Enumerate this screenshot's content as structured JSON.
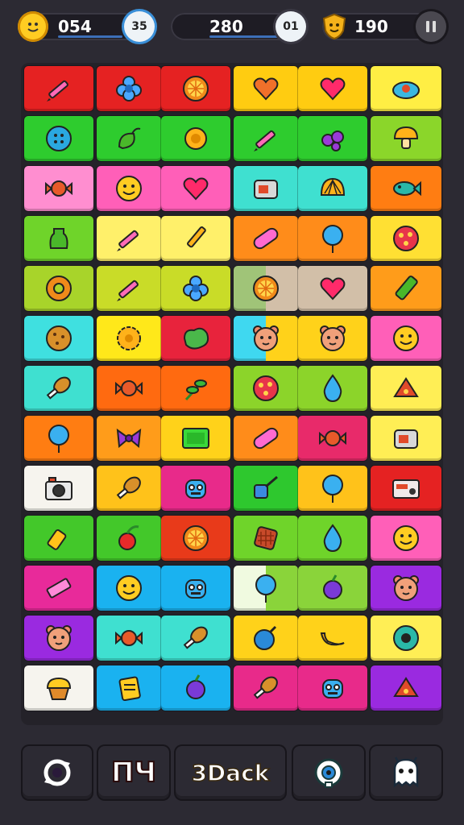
{
  "hud": {
    "coins": {
      "value": "054",
      "badge": "35"
    },
    "score": {
      "value": "280",
      "badge": "01"
    },
    "stars": {
      "value": "190"
    }
  },
  "board": {
    "rows": [
      [
        {
          "c1": "#e52222",
          "icon": "pencil-icon"
        },
        {
          "c1": "#e52222",
          "icon": "flower-icon"
        },
        {
          "c1": "#e52222",
          "icon": "citrus-slice-icon"
        },
        {
          "c1": "#ffcc11",
          "icon": "heart-icon",
          "ic": "#f0702a"
        },
        {
          "c1": "#ffcc11",
          "icon": "heart-icon"
        },
        {
          "c1": "#ffee44",
          "icon": "cloud-bird-icon"
        }
      ],
      [
        {
          "c1": "#2ecc2e",
          "icon": "button-icon"
        },
        {
          "c1": "#2ecc2e",
          "icon": "leaf-fruit-icon"
        },
        {
          "c1": "#2ecc2e",
          "icon": "sun-gear-icon"
        },
        {
          "c1": "#2ecc2e",
          "icon": "pencil-icon"
        },
        {
          "c1": "#2ecc2e",
          "icon": "berries-icon"
        },
        {
          "c1": "#8bd62a",
          "icon": "mushroom-icon"
        }
      ],
      [
        {
          "c1": "#ff8ed0",
          "icon": "candy-icon"
        },
        {
          "c1": "#ff5fb8",
          "icon": "smiley-icon"
        },
        {
          "c1": "#ff5fb8",
          "icon": "heart-icon"
        },
        {
          "c1": "#3fe0d0",
          "icon": "toaster-icon"
        },
        {
          "c1": "#3fe0d0",
          "icon": "shell-icon"
        },
        {
          "c1": "#ff7d12",
          "icon": "fish-icon"
        }
      ],
      [
        {
          "c1": "#6fd42a",
          "icon": "bottle-icon"
        },
        {
          "c1": "#fff06a",
          "icon": "pencil-icon"
        },
        {
          "c1": "#fff06a",
          "icon": "brush-icon"
        },
        {
          "c1": "#ff8c1a",
          "icon": "capsule-icon"
        },
        {
          "c1": "#ff8c1a",
          "icon": "balloon-icon"
        },
        {
          "c1": "#ffe033",
          "icon": "pizza-icon"
        }
      ],
      [
        {
          "c1": "#a8d42a",
          "icon": "donut-icon"
        },
        {
          "c1": "#c9dc28",
          "icon": "pencil-icon"
        },
        {
          "c1": "#c9dc28",
          "icon": "flower-icon"
        },
        {
          "c1": "#a0c478",
          "c2": "#d2bfa8",
          "icon": "citrus-slice-icon"
        },
        {
          "c1": "#d2bfa8",
          "icon": "heart-icon"
        },
        {
          "c1": "#ff9c1a",
          "icon": "crayon-icon"
        }
      ],
      [
        {
          "c1": "#3fe0e0",
          "icon": "cookie-icon"
        },
        {
          "c1": "#ffe81a",
          "icon": "gear-icon"
        },
        {
          "c1": "#e8233c",
          "icon": "splat-icon"
        },
        {
          "c1": "#3fd8f0",
          "c2": "#ffd21a",
          "icon": "bear-face-icon"
        },
        {
          "c1": "#ffd21a",
          "icon": "bear-face-icon"
        },
        {
          "c1": "#ff5fb8",
          "icon": "smiley-icon"
        }
      ],
      [
        {
          "c1": "#3fe0d0",
          "icon": "drumstick-icon"
        },
        {
          "c1": "#ff6a10",
          "icon": "candy-icon"
        },
        {
          "c1": "#ff6a10",
          "icon": "herb-icon"
        },
        {
          "c1": "#8cd42a",
          "icon": "pizza-icon"
        },
        {
          "c1": "#8cd42a",
          "icon": "drop-icon"
        },
        {
          "c1": "#ffee55",
          "icon": "cheese-icon"
        }
      ],
      [
        {
          "c1": "#ff7d12",
          "icon": "balloon-icon"
        },
        {
          "c1": "#ff9c1a",
          "icon": "bow-icon"
        },
        {
          "c1": "#ffd21a",
          "icon": "frame-icon"
        },
        {
          "c1": "#ff8c1a",
          "icon": "capsule-icon"
        },
        {
          "c1": "#e82a6a",
          "icon": "candy-icon"
        },
        {
          "c1": "#ffee55",
          "icon": "toaster-icon"
        }
      ],
      [
        {
          "c1": "#f6f4ee",
          "icon": "camera-icon"
        },
        {
          "c1": "#ffc21a",
          "icon": "drumstick-icon"
        },
        {
          "c1": "#e82a8a",
          "icon": "robot-icon"
        },
        {
          "c1": "#2ec82e",
          "icon": "shovel-icon"
        },
        {
          "c1": "#ffc21a",
          "icon": "balloon-icon"
        },
        {
          "c1": "#e52222",
          "icon": "radio-icon"
        }
      ],
      [
        {
          "c1": "#43c82a",
          "icon": "glue-icon"
        },
        {
          "c1": "#43c82a",
          "icon": "cherry-icon"
        },
        {
          "c1": "#e83a1a",
          "icon": "citrus-slice-icon"
        },
        {
          "c1": "#6fd42a",
          "icon": "waffle-icon"
        },
        {
          "c1": "#6fd42a",
          "icon": "drop-icon"
        },
        {
          "c1": "#ff5fb8",
          "icon": "smiley-icon"
        }
      ],
      [
        {
          "c1": "#e82a9a",
          "icon": "eraser-icon"
        },
        {
          "c1": "#1ab2f0",
          "icon": "smiley-icon"
        },
        {
          "c1": "#1ab2f0",
          "icon": "robot-icon"
        },
        {
          "c1": "#f0fae0",
          "c2": "#8ad43a",
          "icon": "balloon-icon"
        },
        {
          "c1": "#8ad43a",
          "icon": "grape-icon"
        },
        {
          "c1": "#9a2ae0",
          "icon": "bear-face-icon"
        }
      ],
      [
        {
          "c1": "#9a2ae0",
          "icon": "bear-face-icon"
        },
        {
          "c1": "#3fe0d0",
          "icon": "candy-icon"
        },
        {
          "c1": "#3fe0d0",
          "icon": "drumstick-icon"
        },
        {
          "c1": "#ffd21a",
          "icon": "bomb-icon"
        },
        {
          "c1": "#ffd21a",
          "icon": "banana-icon"
        },
        {
          "c1": "#ffee55",
          "icon": "record-icon"
        }
      ],
      [
        {
          "c1": "#f6f4ee",
          "icon": "cupcake-icon"
        },
        {
          "c1": "#1ab2f0",
          "icon": "note-icon"
        },
        {
          "c1": "#1ab2f0",
          "icon": "grape-icon"
        },
        {
          "c1": "#e82a8a",
          "icon": "drumstick-icon"
        },
        {
          "c1": "#e82a8a",
          "icon": "robot-icon"
        },
        {
          "c1": "#9a2ae0",
          "icon": "cheese-icon"
        }
      ]
    ]
  },
  "toolbar": {
    "items": [
      {
        "name": "shuffle-tool",
        "bg": "#8c2ae0",
        "icon": "swirl-icon"
      },
      {
        "name": "hammer-tool",
        "bg": "#e52222",
        "label": "ПЧ"
      },
      {
        "name": "back-tool",
        "bg": "#ffcc11",
        "label": "3Dack"
      },
      {
        "name": "magnet-tool",
        "bg": "#2ed8a8",
        "icon": "eye-icon"
      },
      {
        "name": "hint-tool",
        "bg": "#22a8f0",
        "icon": "ghost-icon"
      }
    ]
  },
  "colors": {
    "background": "#2c2a33",
    "board": "#242229"
  }
}
